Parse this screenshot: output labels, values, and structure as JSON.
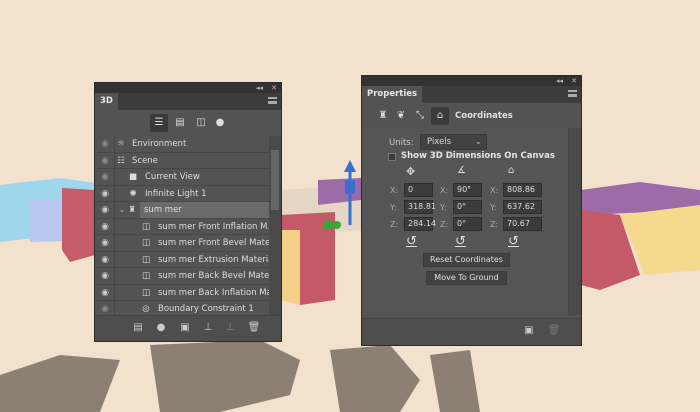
{
  "panel3d": {
    "tab": "3D",
    "collapse": "◂◂",
    "close": "✕",
    "items": [
      {
        "label": "Environment",
        "icon": "environment-icon",
        "visible": "dim"
      },
      {
        "label": "Scene",
        "icon": "scene-icon",
        "visible": "dim"
      },
      {
        "label": "Current View",
        "icon": "camera-icon",
        "visible": "dim"
      },
      {
        "label": "Infinite Light 1",
        "icon": "light-icon",
        "visible": "on"
      },
      {
        "label": "sum mer",
        "icon": "mesh-icon",
        "visible": "on"
      },
      {
        "label": "sum mer Front Inflation M...",
        "icon": "material-icon",
        "visible": "on"
      },
      {
        "label": "sum mer Front Bevel Mate...",
        "icon": "material-icon",
        "visible": "on"
      },
      {
        "label": "sum mer Extrusion Material",
        "icon": "material-icon",
        "visible": "on"
      },
      {
        "label": "sum mer Back Bevel Material",
        "icon": "material-icon",
        "visible": "on"
      },
      {
        "label": "sum mer Back Inflation Ma...",
        "icon": "material-icon",
        "visible": "on"
      },
      {
        "label": "Boundary Constraint 1",
        "icon": "constraint-icon",
        "visible": "dim"
      }
    ]
  },
  "properties": {
    "tab": "Properties",
    "collapse": "◂◂",
    "close": "✕",
    "section": "Coordinates",
    "units_label": "Units:",
    "units_value": "Pixels",
    "show_dims": "Show 3D Dimensions On Canvas",
    "position": {
      "x": "0",
      "y": "318.81",
      "z": "284.14"
    },
    "rotation": {
      "x": "90°",
      "y": "0°",
      "z": "0°"
    },
    "scale": {
      "x": "808.86",
      "y": "637.62",
      "z": "70.67"
    },
    "axes": {
      "x": "X:",
      "y": "Y:",
      "z": "Z:"
    },
    "reset_coords": "Reset Coordinates",
    "move_ground": "Move To Ground"
  }
}
